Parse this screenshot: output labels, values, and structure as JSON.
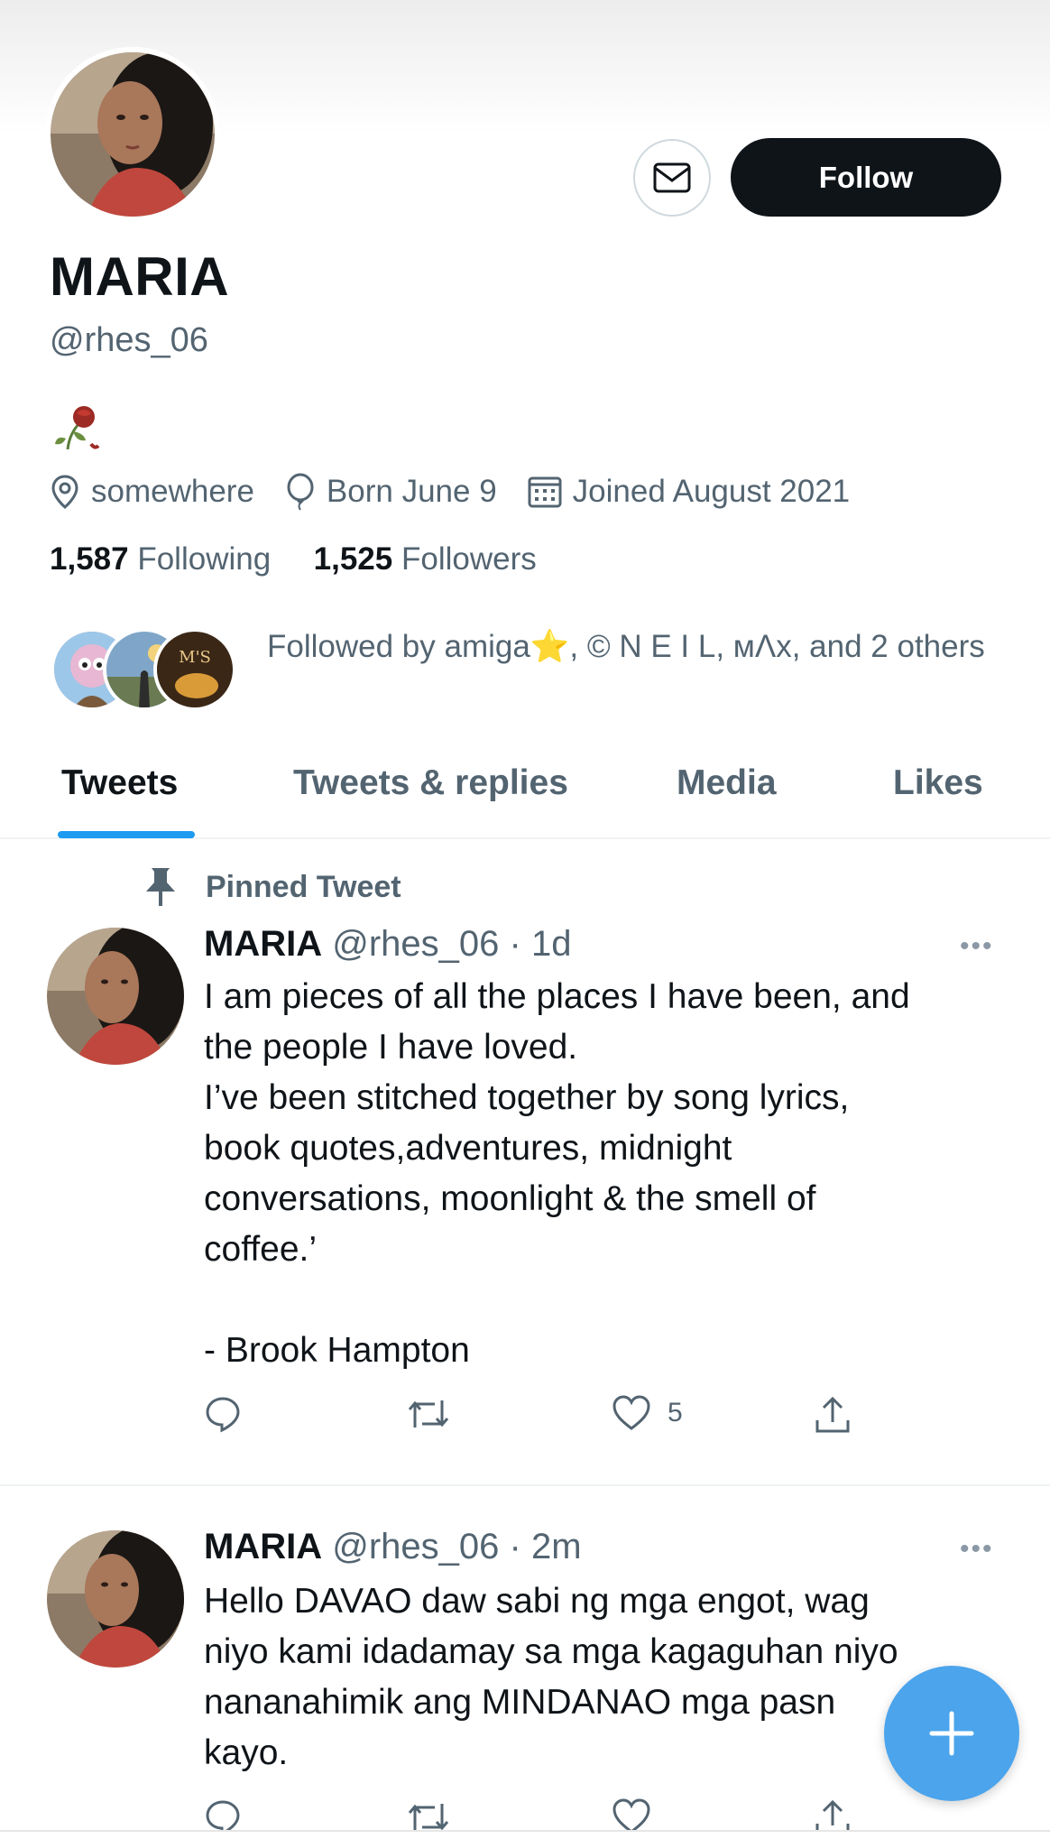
{
  "profile": {
    "display_name": "MARIA",
    "handle": "@rhes_06",
    "bio_icon": "wilted-rose-emoji",
    "location": "somewhere",
    "birthday": "Born June 9",
    "joined": "Joined August 2021",
    "following_count": "1,587",
    "following_label": "Following",
    "followers_count": "1,525",
    "followers_label": "Followers",
    "followed_by": "Followed by amiga⭐, © N E I L, мΛx, and 2 others"
  },
  "actions": {
    "message_icon": "envelope-icon",
    "follow_label": "Follow"
  },
  "tabs": [
    {
      "label": "Tweets",
      "active": true
    },
    {
      "label": "Tweets & replies",
      "active": false
    },
    {
      "label": "Media",
      "active": false
    },
    {
      "label": "Likes",
      "active": false
    }
  ],
  "tweets": [
    {
      "pinned_label": "Pinned Tweet",
      "name": "MARIA",
      "handle": "@rhes_06",
      "sep": "·",
      "time": "1d",
      "more": "•••",
      "text": "I am pieces of all the places I have been, and\nthe people I have loved.\nI’ve been stitched together by song lyrics,\nbook quotes,adventures, midnight\nconversations, moonlight & the smell of\ncoffee.’\n\n- Brook Hampton",
      "like_count": "5"
    },
    {
      "name": "MARIA",
      "handle": "@rhes_06",
      "sep": "·",
      "time": "2m",
      "more": "•••",
      "text": "Hello DAVAO daw sabi ng mga engot, wag\nniyo kami idadamay sa mga kagaguhan niyo\nnananahimik ang MINDANAO mga pasn\nkayo."
    }
  ],
  "colors": {
    "accent": "#1d9bf0",
    "fab": "#4ba4ec",
    "follow_bg": "#0f1419",
    "secondary_text": "#536471"
  }
}
